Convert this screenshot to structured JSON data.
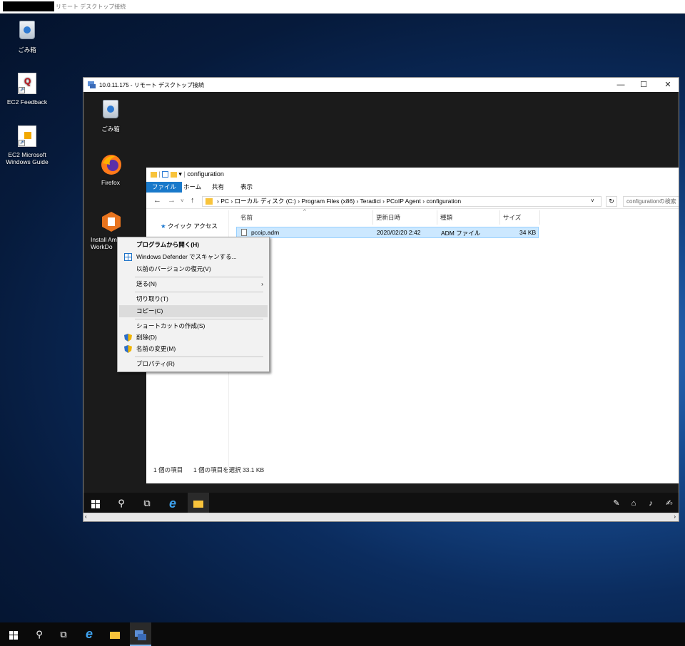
{
  "outer_window": {
    "title": "リモート デスクトップ接続"
  },
  "desktop_icons": [
    {
      "label": "ごみ箱",
      "icon": "recycle-bin-icon"
    },
    {
      "label": "EC2 Feedback",
      "icon": "feedback-icon"
    },
    {
      "label": "EC2 Microsoft Windows Guide",
      "icon": "guide-icon"
    }
  ],
  "remote_window": {
    "title": "10.0.11.175 - リモート デスクトップ接続",
    "controls": {
      "minimize": "—",
      "maximize": "☐",
      "close": "✕"
    },
    "desktop_icons": [
      {
        "label": "ごみ箱"
      },
      {
        "label": "Firefox"
      },
      {
        "label": "Install Am WorkDo"
      }
    ]
  },
  "explorer": {
    "title": "configuration",
    "ribbon_tabs": [
      "ファイル",
      "ホーム",
      "共有",
      "表示"
    ],
    "path": [
      "PC",
      "ローカル ディスク (C:)",
      "Program Files (x86)",
      "Teradici",
      "PCoIP Agent",
      "configuration"
    ],
    "search_placeholder": "configurationの検索",
    "nav_quick_access": "クイック アクセス",
    "columns": [
      "名前",
      "更新日時",
      "種類",
      "サイズ"
    ],
    "files": [
      {
        "name": "pcoip.adm",
        "modified": "2020/02/20 2:42",
        "type": "ADM ファイル",
        "size": "34 KB"
      }
    ],
    "status_items": "1 個の項目",
    "status_selected": "1 個の項目を選択 33.1 KB"
  },
  "context_menu": {
    "items": [
      "プログラムから開く(H)",
      "Windows Defender でスキャンする...",
      "以前のバージョンの復元(V)",
      "送る(N)",
      "切り取り(T)",
      "コピー(C)",
      "ショートカットの作成(S)",
      "削除(D)",
      "名前の変更(M)",
      "プロパティ(R)"
    ],
    "highlighted": "コピー(C)"
  },
  "colors": {
    "accent": "#0078d7",
    "selection": "#cce8ff",
    "folder": "#f8c33b"
  }
}
